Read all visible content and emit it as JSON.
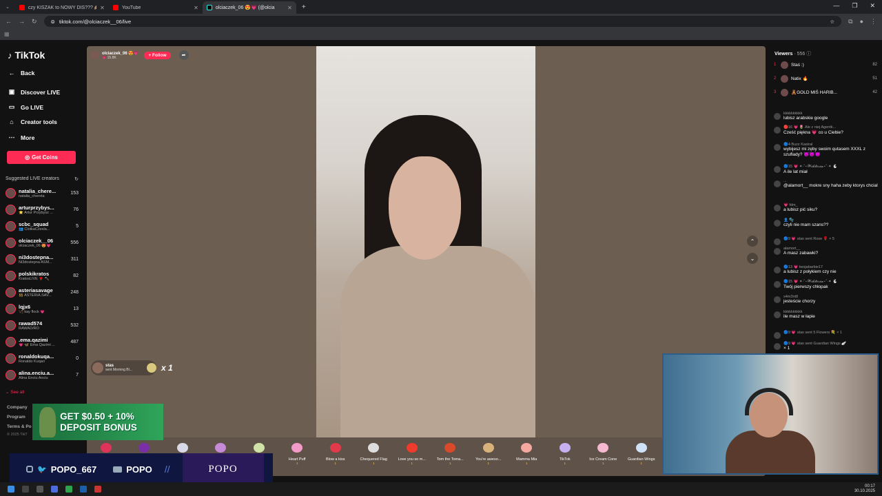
{
  "browser": {
    "tabs": [
      {
        "title": "czy KISZAK to NOWY DIS??? 🙈"
      },
      {
        "title": "YouTube"
      },
      {
        "title": "olciaczek_06 😍💗 (@olcia"
      }
    ],
    "url": "tiktok.com/@olciaczek__06/live"
  },
  "sidebar": {
    "logo": "TikTok",
    "nav": [
      {
        "label": "Back",
        "icon": "arrow-left-icon"
      },
      {
        "label": "Discover LIVE",
        "icon": "discover-icon"
      },
      {
        "label": "Go LIVE",
        "icon": "camera-icon"
      },
      {
        "label": "Creator tools",
        "icon": "home-icon"
      },
      {
        "label": "More",
        "icon": "more-icon"
      }
    ],
    "get_coins": "Get Coins",
    "suggested_title": "Suggested LIVE creators",
    "creators": [
      {
        "name": "natalia_chere...",
        "sub": "natalia_chereta",
        "count": "153"
      },
      {
        "name": "arturprzybys...",
        "sub": "⭐ Artur Przybysz ...",
        "count": "76"
      },
      {
        "name": "scbc_squad",
        "sub": "👥 ClotkaCzesla...",
        "count": "5"
      },
      {
        "name": "olciaczek__06",
        "sub": "olciaczek_06 😍💗",
        "count": "556"
      },
      {
        "name": "ni3dostepna...",
        "sub": "Ni3dostepna ASM...",
        "count": "311"
      },
      {
        "name": "polskikratos",
        "sub": "KratosLIVE 🌹 🔨",
        "count": "82"
      },
      {
        "name": "asteriasavage",
        "sub": "👯 ASTERIA.SAV...",
        "count": "248"
      },
      {
        "name": "lqjx6",
        "sub": "🏹 kay flock 💗",
        "count": "13"
      },
      {
        "name": "rawad574",
        "sub": "RAWAD/RO",
        "count": "532"
      },
      {
        "name": ".ema.qazimi",
        "sub": "💗 🦋 Ema Qazimi ...",
        "count": "487"
      },
      {
        "name": "ronaldokuqa...",
        "sub": "Ronaldo Kuqari",
        "count": "0"
      },
      {
        "name": "alina.enciu.a...",
        "sub": "Alina Enciu Anciu",
        "count": "7"
      }
    ],
    "see_all": "See all",
    "footer": [
      "Company",
      "Program",
      "Terms & Po"
    ],
    "copyright": "© 2025 TikT"
  },
  "stream": {
    "host_name": "olciaczek_06 😍💗",
    "host_likes": "💗 15.8K",
    "follow": "+ Follow",
    "gift_notice": {
      "user": "stas",
      "message": "sent Morning Bl...",
      "multiplier": "x 1"
    },
    "gifts": [
      {
        "label": "",
        "price": "",
        "color": "#e0335a"
      },
      {
        "label": "",
        "price": "",
        "color": "#7a2fa8"
      },
      {
        "label": "",
        "price": "",
        "color": "#d8d8e8"
      },
      {
        "label": "",
        "price": "",
        "color": "#c58ad8"
      },
      {
        "label": "",
        "price": "",
        "color": "#cfe3a8"
      },
      {
        "label": "Heart Puff",
        "price": "1",
        "color": "#f29bc8"
      },
      {
        "label": "Blow a kiss",
        "price": "1",
        "color": "#e23a4a"
      },
      {
        "label": "Chequered Flag",
        "price": "1",
        "color": "#dddddd"
      },
      {
        "label": "Love you so m...",
        "price": "1",
        "color": "#ef3b2b"
      },
      {
        "label": "Tom the Toma...",
        "price": "1",
        "color": "#d94a2a"
      },
      {
        "label": "You're aweso...",
        "price": "1",
        "color": "#d8b27a"
      },
      {
        "label": "Mamma Mia",
        "price": "1",
        "color": "#f3a8a0"
      },
      {
        "label": "TikTok",
        "price": "1",
        "color": "#c6b0f0"
      },
      {
        "label": "Ice Cream Cone",
        "price": "1",
        "color": "#f5b8d0"
      },
      {
        "label": "Guardian Wings",
        "price": "1",
        "color": "#cfe2f8"
      }
    ]
  },
  "viewers": {
    "title": "Viewers",
    "count": "· 556",
    "top": [
      {
        "rank": "1",
        "name": "Staś :)",
        "score": "82"
      },
      {
        "rank": "2",
        "name": "Natix 🔥",
        "score": "51"
      },
      {
        "rank": "3",
        "name": "🧸GOLD MIŚ HARIB...",
        "score": "42"
      }
    ]
  },
  "chat": [
    {
      "user": "kkkkkkkkkk",
      "text": "lubisz arabskie google"
    },
    {
      "user": "🔴16 💗 🌷 Ale z niej Agentk...",
      "text": "Cześć piękna 💗 co u Ciebie?"
    },
    {
      "user": "🔵4 Buzz Kastral",
      "text": "wybijesz mi zęby swoim qutasem XXXL z szuflady? 😈😈😈"
    },
    {
      "user": "🔵15 💗 ✦·˚⋆𝓦𝓲𝓴𝓽𝓸𝓻𝓲𝓪⋆˚·✦ 🐇",
      "text": "A ile lat miał"
    },
    {
      "user": "...",
      "text": "@alamort__ mokre sny haha zeby ktorys chcial"
    },
    {
      "user": "💗 fdm_",
      "text": "a lubisz pić siku?"
    },
    {
      "user": "👤 🫧",
      "text": "czyli nie mam szans??"
    },
    {
      "user": "🔵9 💗 stas sent Rose 🌹 × 5",
      "text": ""
    },
    {
      "user": "alamort__",
      "text": "A masz zabawki?"
    },
    {
      "user": "🔵13 💗 twojabarbie17",
      "text": "a lubisz z połykiem czy nie"
    },
    {
      "user": "🔵15 💗 ✦·˚⋆𝓦𝓲𝓴𝓽𝓸𝓻𝓲𝓪⋆˚·✦ 🐇",
      "text": "Twój pierwszy chłopak"
    },
    {
      "user": "s4m3nt8",
      "text": "jesteście chorzy"
    },
    {
      "user": "kkkkkkkkkk",
      "text": "ile masz w łapie"
    },
    {
      "user": "🔵9 💗 stas sent 5 Flowers 💐 × 1",
      "text": ""
    },
    {
      "user": "🔵9 💗 stas sent Guardian Wings 🪽",
      "text": "× 1"
    }
  ],
  "overlay": {
    "promo": "GET $0.50 + 10% DEPOSIT BONUS",
    "handle_social": "POPO_667",
    "handle_yt": "POPO",
    "brand": "POPO"
  },
  "taskbar": {
    "time": "00:17",
    "date": "30.10.2025"
  }
}
